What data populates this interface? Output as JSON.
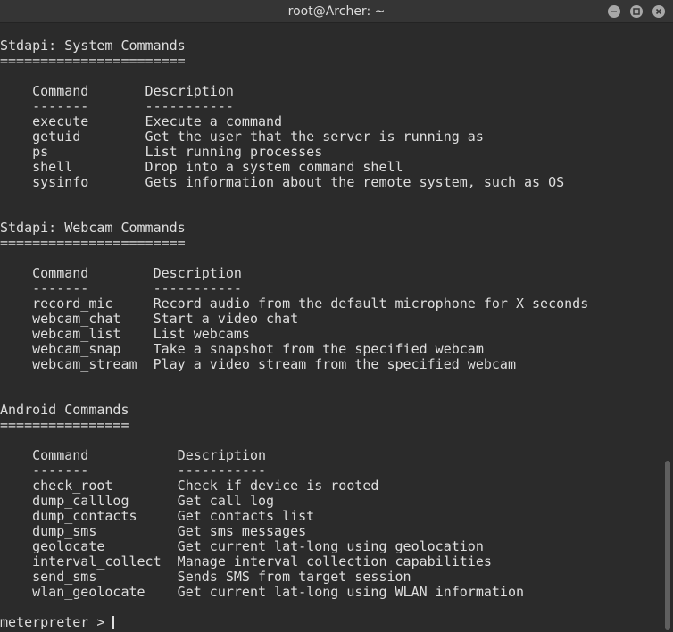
{
  "window": {
    "title": "root@Archer: ~"
  },
  "sections": [
    {
      "heading": "Stdapi: System Commands",
      "underline": "=======================",
      "col_header": "    Command       Description",
      "col_rule": "    -------       -----------",
      "rows": [
        "    execute       Execute a command",
        "    getuid        Get the user that the server is running as",
        "    ps            List running processes",
        "    shell         Drop into a system command shell",
        "    sysinfo       Gets information about the remote system, such as OS"
      ]
    },
    {
      "heading": "Stdapi: Webcam Commands",
      "underline": "=======================",
      "col_header": "    Command        Description",
      "col_rule": "    -------        -----------",
      "rows": [
        "    record_mic     Record audio from the default microphone for X seconds",
        "    webcam_chat    Start a video chat",
        "    webcam_list    List webcams",
        "    webcam_snap    Take a snapshot from the specified webcam",
        "    webcam_stream  Play a video stream from the specified webcam"
      ]
    },
    {
      "heading": "Android Commands",
      "underline": "================",
      "col_header": "    Command           Description",
      "col_rule": "    -------           -----------",
      "rows": [
        "    check_root        Check if device is rooted",
        "    dump_calllog      Get call log",
        "    dump_contacts     Get contacts list",
        "    dump_sms          Get sms messages",
        "    geolocate         Get current lat-long using geolocation",
        "    interval_collect  Manage interval collection capabilities",
        "    send_sms          Sends SMS from target session",
        "    wlan_geolocate    Get current lat-long using WLAN information"
      ]
    }
  ],
  "prompt": {
    "word": "meterpreter",
    "suffix": " > "
  },
  "icons": {
    "minimize": "minimize-icon",
    "maximize": "maximize-icon",
    "close": "close-icon"
  }
}
